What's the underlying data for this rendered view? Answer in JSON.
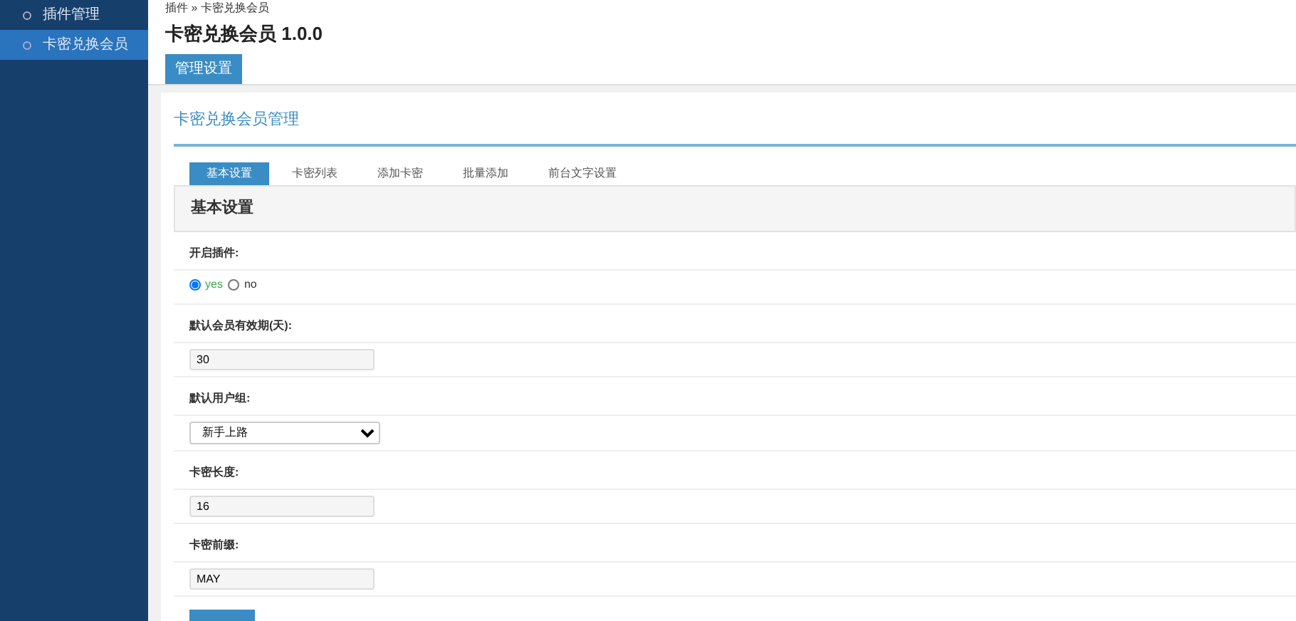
{
  "sidebar": {
    "items": [
      {
        "label": "插件管理",
        "selected": false
      },
      {
        "label": "卡密兑换会员",
        "selected": true
      }
    ]
  },
  "breadcrumb": "插件 » 卡密兑换会员",
  "title": "卡密兑换会员 1.0.0",
  "header_button": "管理设置",
  "panel_title": "卡密兑换会员管理",
  "tabs": [
    {
      "label": "基本设置",
      "selected": true
    },
    {
      "label": "卡密列表",
      "selected": false
    },
    {
      "label": "添加卡密",
      "selected": false
    },
    {
      "label": "批量添加",
      "selected": false
    },
    {
      "label": "前台文字设置",
      "selected": false
    }
  ],
  "section_title": "基本设置",
  "fields": [
    {
      "kind": "radio",
      "label": "开启插件:",
      "options": [
        {
          "label": "yes",
          "selected": true
        },
        {
          "label": "no",
          "selected": false
        }
      ]
    },
    {
      "kind": "text",
      "label": "默认会员有效期(天):",
      "value": "30"
    },
    {
      "kind": "select",
      "label": "默认用户组:",
      "value": "新手上路"
    },
    {
      "kind": "text",
      "label": "卡密长度:",
      "value": "16"
    },
    {
      "kind": "text",
      "label": "卡密前缀:",
      "value": "MAY"
    }
  ]
}
